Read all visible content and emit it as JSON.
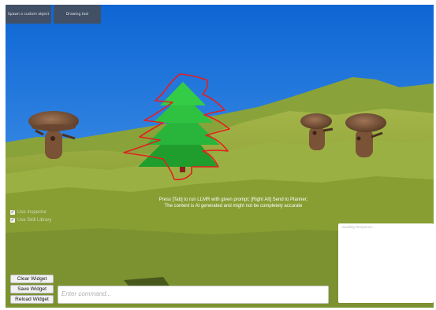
{
  "toolbar": {
    "spawn_label": "Spawn a custom object",
    "drawing_label": "Drawing tool"
  },
  "notice": {
    "line1": "Press [Tab] to run LLMR with given prompt; [Right Alt] Send to Planner;",
    "line2": "The content is AI generated and might not be completely accurate"
  },
  "toggles": [
    {
      "label": "Use Inspector",
      "checked": true
    },
    {
      "label": "Use Skill Library",
      "checked": true
    }
  ],
  "response": {
    "placeholder": "Awaiting Response..."
  },
  "widgets": {
    "clear_label": "Clear Widget",
    "save_label": "Save Widget",
    "reload_label": "Reload Widget"
  },
  "command": {
    "placeholder": "Enter command..."
  },
  "colors": {
    "sky": "#1d7fe0",
    "terrain": "#8ea53a",
    "tree": "#27b83a",
    "sketch": "#e41f1f",
    "panel": "#464e5c"
  }
}
